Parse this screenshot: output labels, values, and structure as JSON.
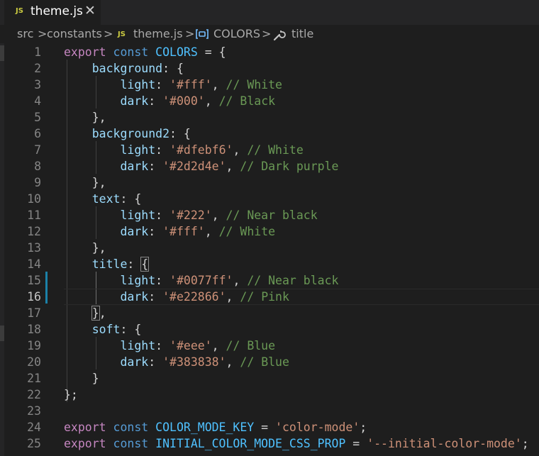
{
  "tab": {
    "lang_badge": "JS",
    "file_name": "theme.js",
    "close_glyph": "✕"
  },
  "breadcrumb": {
    "items": [
      "src",
      "constants",
      "theme.js",
      "COLORS",
      "title"
    ],
    "file_badge": "JS",
    "separator": ">"
  },
  "editor": {
    "active_line": 16,
    "modified_lines": [
      15,
      16
    ],
    "lines": [
      {
        "n": "1",
        "tokens": [
          [
            "k",
            "export"
          ],
          [
            "p",
            " "
          ],
          [
            "s",
            "const"
          ],
          [
            "p",
            " "
          ],
          [
            "c",
            "COLORS"
          ],
          [
            "p",
            " = {"
          ]
        ]
      },
      {
        "n": "2",
        "tokens": [
          [
            "p",
            "    "
          ],
          [
            "pr",
            "background"
          ],
          [
            "p",
            ": {"
          ]
        ]
      },
      {
        "n": "3",
        "tokens": [
          [
            "p",
            "        "
          ],
          [
            "pr",
            "light"
          ],
          [
            "p",
            ": "
          ],
          [
            "st",
            "'#fff'"
          ],
          [
            "p",
            ", "
          ],
          [
            "cm",
            "// White"
          ]
        ]
      },
      {
        "n": "4",
        "tokens": [
          [
            "p",
            "        "
          ],
          [
            "pr",
            "dark"
          ],
          [
            "p",
            ": "
          ],
          [
            "st",
            "'#000'"
          ],
          [
            "p",
            ", "
          ],
          [
            "cm",
            "// Black"
          ]
        ]
      },
      {
        "n": "5",
        "tokens": [
          [
            "p",
            "    },"
          ]
        ]
      },
      {
        "n": "6",
        "tokens": [
          [
            "p",
            "    "
          ],
          [
            "pr",
            "background2"
          ],
          [
            "p",
            ": {"
          ]
        ]
      },
      {
        "n": "7",
        "tokens": [
          [
            "p",
            "        "
          ],
          [
            "pr",
            "light"
          ],
          [
            "p",
            ": "
          ],
          [
            "st",
            "'#dfebf6'"
          ],
          [
            "p",
            ", "
          ],
          [
            "cm",
            "// White"
          ]
        ]
      },
      {
        "n": "8",
        "tokens": [
          [
            "p",
            "        "
          ],
          [
            "pr",
            "dark"
          ],
          [
            "p",
            ": "
          ],
          [
            "st",
            "'#2d2d4e'"
          ],
          [
            "p",
            ", "
          ],
          [
            "cm",
            "// Dark purple"
          ]
        ]
      },
      {
        "n": "9",
        "tokens": [
          [
            "p",
            "    },"
          ]
        ]
      },
      {
        "n": "10",
        "tokens": [
          [
            "p",
            "    "
          ],
          [
            "pr",
            "text"
          ],
          [
            "p",
            ": {"
          ]
        ]
      },
      {
        "n": "11",
        "tokens": [
          [
            "p",
            "        "
          ],
          [
            "pr",
            "light"
          ],
          [
            "p",
            ": "
          ],
          [
            "st",
            "'#222'"
          ],
          [
            "p",
            ", "
          ],
          [
            "cm",
            "// Near black"
          ]
        ]
      },
      {
        "n": "12",
        "tokens": [
          [
            "p",
            "        "
          ],
          [
            "pr",
            "dark"
          ],
          [
            "p",
            ": "
          ],
          [
            "st",
            "'#fff'"
          ],
          [
            "p",
            ", "
          ],
          [
            "cm",
            "// White"
          ]
        ]
      },
      {
        "n": "13",
        "tokens": [
          [
            "p",
            "    },"
          ]
        ]
      },
      {
        "n": "14",
        "tokens": [
          [
            "p",
            "    "
          ],
          [
            "pr",
            "title"
          ],
          [
            "p",
            ": "
          ],
          [
            "br",
            "{"
          ]
        ]
      },
      {
        "n": "15",
        "tokens": [
          [
            "p",
            "        "
          ],
          [
            "pr",
            "light"
          ],
          [
            "p",
            ": "
          ],
          [
            "st",
            "'#0077ff'"
          ],
          [
            "p",
            ", "
          ],
          [
            "cm",
            "// Near black"
          ]
        ]
      },
      {
        "n": "16",
        "tokens": [
          [
            "p",
            "        "
          ],
          [
            "pr",
            "dark"
          ],
          [
            "p",
            ": "
          ],
          [
            "st",
            "'#e22866'"
          ],
          [
            "p",
            ", "
          ],
          [
            "cm",
            "// Pink"
          ]
        ]
      },
      {
        "n": "17",
        "tokens": [
          [
            "p",
            "    "
          ],
          [
            "br",
            "}"
          ],
          [
            "p",
            ","
          ]
        ]
      },
      {
        "n": "18",
        "tokens": [
          [
            "p",
            "    "
          ],
          [
            "pr",
            "soft"
          ],
          [
            "p",
            ": {"
          ]
        ]
      },
      {
        "n": "19",
        "tokens": [
          [
            "p",
            "        "
          ],
          [
            "pr",
            "light"
          ],
          [
            "p",
            ": "
          ],
          [
            "st",
            "'#eee'"
          ],
          [
            "p",
            ", "
          ],
          [
            "cm",
            "// Blue"
          ]
        ]
      },
      {
        "n": "20",
        "tokens": [
          [
            "p",
            "        "
          ],
          [
            "pr",
            "dark"
          ],
          [
            "p",
            ": "
          ],
          [
            "st",
            "'#383838'"
          ],
          [
            "p",
            ", "
          ],
          [
            "cm",
            "// Blue"
          ]
        ]
      },
      {
        "n": "21",
        "tokens": [
          [
            "p",
            "    }"
          ]
        ]
      },
      {
        "n": "22",
        "tokens": [
          [
            "p",
            "};"
          ]
        ]
      },
      {
        "n": "23",
        "tokens": []
      },
      {
        "n": "24",
        "tokens": [
          [
            "k",
            "export"
          ],
          [
            "p",
            " "
          ],
          [
            "s",
            "const"
          ],
          [
            "p",
            " "
          ],
          [
            "c",
            "COLOR_MODE_KEY"
          ],
          [
            "p",
            " = "
          ],
          [
            "st",
            "'color-mode'"
          ],
          [
            "p",
            ";"
          ]
        ]
      },
      {
        "n": "25",
        "tokens": [
          [
            "k",
            "export"
          ],
          [
            "p",
            " "
          ],
          [
            "s",
            "const"
          ],
          [
            "p",
            " "
          ],
          [
            "c",
            "INITIAL_COLOR_MODE_CSS_PROP"
          ],
          [
            "p",
            " = "
          ],
          [
            "st",
            "'--initial-color-mode'"
          ],
          [
            "p",
            ";"
          ]
        ]
      }
    ]
  },
  "colors": {
    "keyword": "#c586c0",
    "storage": "#569cd6",
    "constant": "#4fc1ff",
    "property": "#9cdcfe",
    "string": "#ce9178",
    "comment": "#6a9955",
    "modified_gutter": "#1b81a8"
  }
}
